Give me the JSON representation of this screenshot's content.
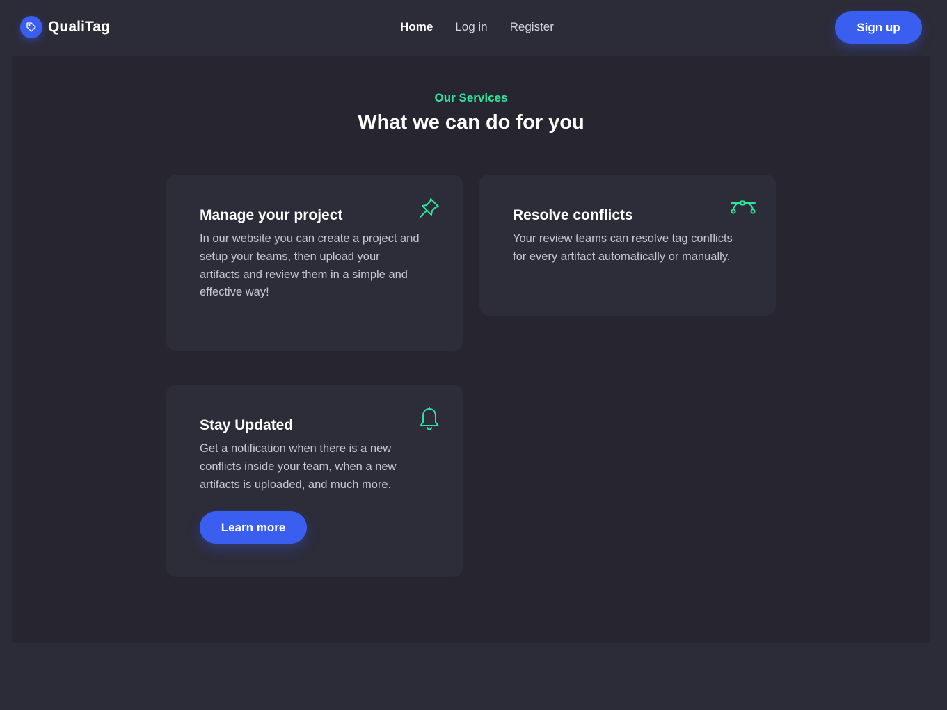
{
  "brand": {
    "name": "QualiTag",
    "icon": "tag-icon",
    "accent": "#3a5ef0"
  },
  "nav": {
    "items": [
      {
        "label": "Home",
        "active": true
      },
      {
        "label": "Log in",
        "active": false
      },
      {
        "label": "Register",
        "active": false
      }
    ],
    "signup_label": "Sign up"
  },
  "services": {
    "eyebrow": "Our Services",
    "heading": "What we can do for you",
    "accent": "#2ee59d",
    "cards": [
      {
        "title": "Manage your project",
        "icon": "pin-icon",
        "lines": [
          "In our website you can create a project and",
          "setup your teams, then upload your",
          "artifacts and review them in a simple and",
          "effective way!"
        ]
      },
      {
        "title": "Resolve conflicts",
        "icon": "bezier-curve-icon",
        "lines": [
          "Your review teams can resolve tag conflicts",
          "for every artifact automatically or manually."
        ]
      },
      {
        "title": "Stay Updated",
        "icon": "bell-icon",
        "lines": [
          "Get a notification when there is a new",
          "conflicts inside your team, when a new",
          "artifacts is uploaded, and much more."
        ],
        "button_label": "Learn more"
      }
    ]
  }
}
